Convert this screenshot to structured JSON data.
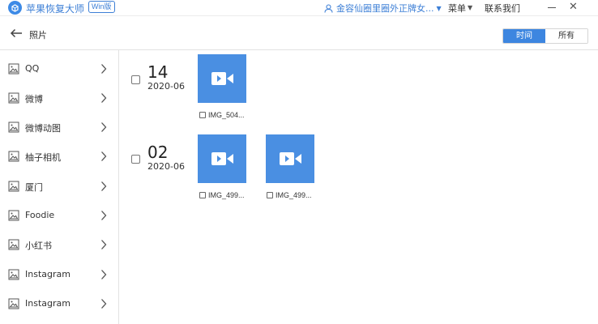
{
  "app": {
    "title": "苹果恢复大师",
    "badge": "Win版",
    "user_name": "金容仙圈里圈外正牌女...",
    "menu_label": "菜单",
    "contact_label": "联系我们"
  },
  "toolbar": {
    "title": "照片",
    "segments": [
      "时间",
      "所有"
    ],
    "active_segment": "时间"
  },
  "sidebar": {
    "items": [
      {
        "label": "QQ"
      },
      {
        "label": "微博"
      },
      {
        "label": "微博动图"
      },
      {
        "label": "柚子相机"
      },
      {
        "label": "厦门"
      },
      {
        "label": "Foodie"
      },
      {
        "label": "小红书"
      },
      {
        "label": "Instagram"
      },
      {
        "label": "Instagram"
      }
    ]
  },
  "groups": [
    {
      "day": "14",
      "month": "2020-06",
      "items": [
        {
          "name": "IMG_504..."
        }
      ]
    },
    {
      "day": "02",
      "month": "2020-06",
      "items": [
        {
          "name": "IMG_499..."
        },
        {
          "name": "IMG_499..."
        }
      ]
    }
  ],
  "colors": {
    "accent": "#3d86e0",
    "thumb": "#4a8fe2"
  }
}
